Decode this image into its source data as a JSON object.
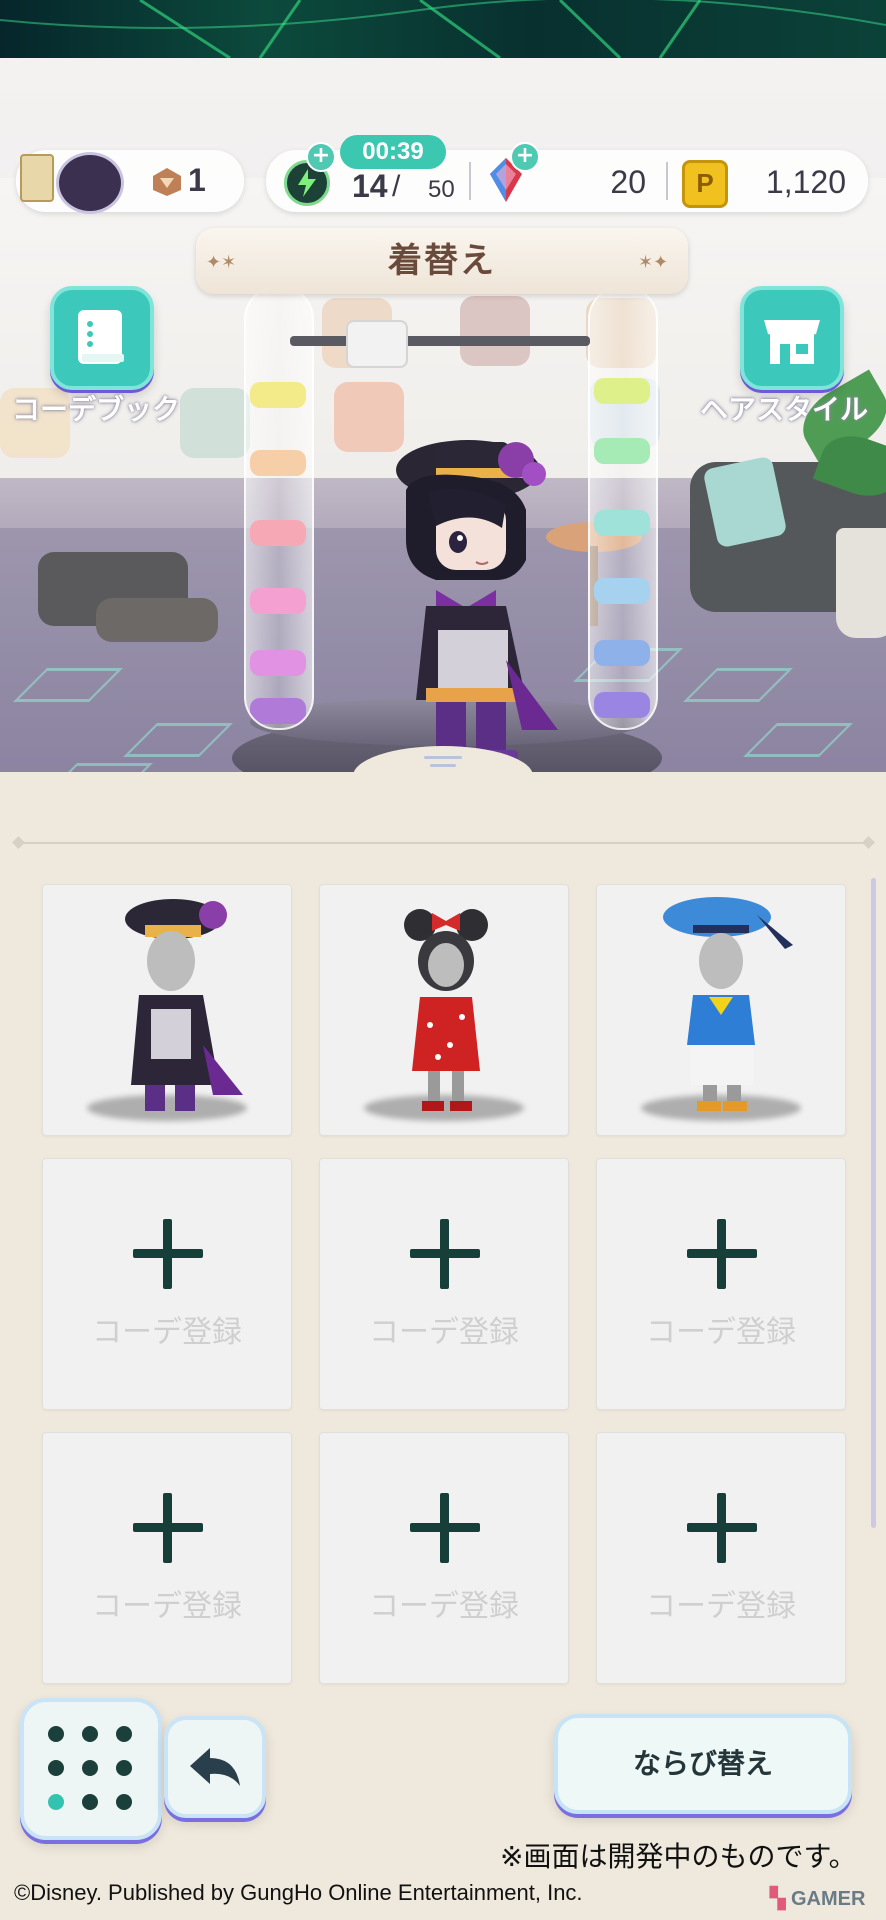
{
  "hud": {
    "tickets": "1",
    "timer": "00:39",
    "stamina_current": "14",
    "stamina_max": "50",
    "gems": "20",
    "coins": "1,120"
  },
  "screen_title": "着替え",
  "side_buttons": {
    "left_label": "コーデブック",
    "right_label": "ヘアスタイル"
  },
  "outfits": [
    {
      "label": "",
      "outfit": "purple-hat-outfit"
    },
    {
      "label": "",
      "outfit": "minnie-outfit"
    },
    {
      "label": "",
      "outfit": "donald-outfit"
    },
    {
      "label": "コーデ登録"
    },
    {
      "label": "コーデ登録"
    },
    {
      "label": "コーデ登録"
    },
    {
      "label": "コーデ登録"
    },
    {
      "label": "コーデ登録"
    },
    {
      "label": "コーデ登録"
    }
  ],
  "buttons": {
    "sort_label": "ならび替え"
  },
  "icons": {
    "profile": "profile-card-icon",
    "ticket": "ticket-icon",
    "stamina": "stamina-bolt-icon",
    "gem": "gem-icon",
    "coin": "coin-icon",
    "codebook": "book-icon",
    "hairstyle": "shop-icon",
    "menu": "grid-menu-icon",
    "back": "back-arrow-icon"
  },
  "colors": {
    "accent_teal": "#3cc9bc",
    "button_shadow": "#7b6ee0",
    "panel_bg": "#efe8dc"
  },
  "footer": {
    "dev_note": "※画面は開発中のものです。",
    "copyright": "©Disney.  Published by GungHo Online Entertainment, Inc.",
    "watermark": "GAMER"
  }
}
